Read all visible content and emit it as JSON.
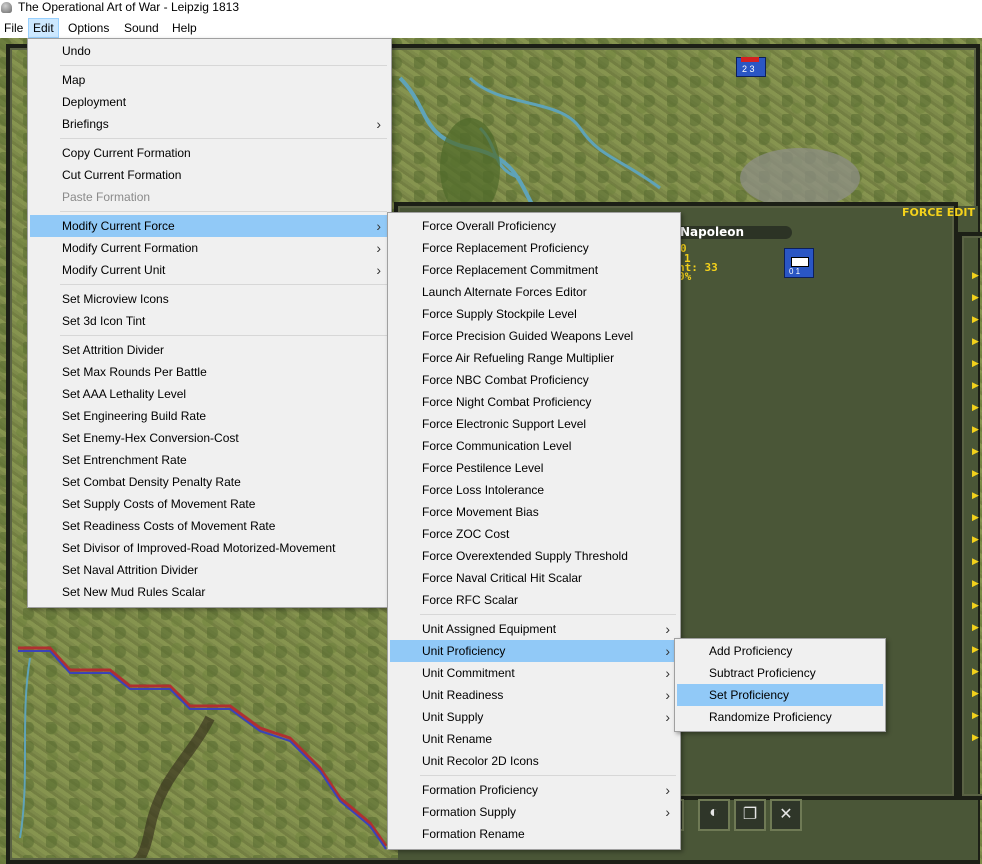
{
  "window": {
    "title": "The Operational Art of War - Leipzig 1813"
  },
  "menubar": [
    "File",
    "Edit",
    "Options",
    "Sound",
    "Help"
  ],
  "edit_menu": [
    {
      "label": "Undo"
    },
    {
      "sep": true
    },
    {
      "label": "Map"
    },
    {
      "label": "Deployment"
    },
    {
      "label": "Briefings",
      "sub": true
    },
    {
      "sep": true
    },
    {
      "label": "Copy Current Formation"
    },
    {
      "label": "Cut Current Formation"
    },
    {
      "label": "Paste Formation",
      "disabled": true
    },
    {
      "sep": true
    },
    {
      "label": "Modify Current Force",
      "sub": true,
      "hl": true
    },
    {
      "label": "Modify Current Formation",
      "sub": true
    },
    {
      "label": "Modify Current Unit",
      "sub": true
    },
    {
      "sep": true
    },
    {
      "label": "Set Microview Icons"
    },
    {
      "label": "Set 3d Icon Tint"
    },
    {
      "sep": true
    },
    {
      "label": "Set Attrition Divider"
    },
    {
      "label": "Set Max Rounds Per Battle"
    },
    {
      "label": "Set AAA Lethality Level"
    },
    {
      "label": "Set Engineering Build Rate"
    },
    {
      "label": "Set Enemy-Hex Conversion-Cost"
    },
    {
      "label": "Set Entrenchment Rate"
    },
    {
      "label": "Set Combat Density Penalty Rate"
    },
    {
      "label": "Set Supply Costs of Movement Rate"
    },
    {
      "label": "Set Readiness Costs of Movement Rate"
    },
    {
      "label": "Set Divisor of Improved-Road Motorized-Movement"
    },
    {
      "label": "Set Naval Attrition Divider"
    },
    {
      "label": "Set New Mud Rules Scalar"
    }
  ],
  "force_menu": [
    {
      "label": "Force Overall Proficiency"
    },
    {
      "label": "Force Replacement Proficiency"
    },
    {
      "label": "Force Replacement Commitment"
    },
    {
      "label": "Launch Alternate Forces Editor"
    },
    {
      "label": "Force Supply Stockpile Level"
    },
    {
      "label": "Force Precision Guided Weapons Level"
    },
    {
      "label": "Force Air Refueling Range Multiplier"
    },
    {
      "label": "Force NBC Combat Proficiency"
    },
    {
      "label": "Force Night Combat Proficiency"
    },
    {
      "label": "Force Electronic Support Level"
    },
    {
      "label": "Force Communication Level"
    },
    {
      "label": "Force Pestilence Level"
    },
    {
      "label": "Force Loss Intolerance"
    },
    {
      "label": "Force Movement Bias"
    },
    {
      "label": "Force ZOC Cost"
    },
    {
      "label": "Force Overextended Supply Threshold"
    },
    {
      "label": "Force Naval Critical Hit Scalar"
    },
    {
      "label": "Force RFC Scalar"
    },
    {
      "sep": true
    },
    {
      "label": "Unit Assigned Equipment",
      "sub": true
    },
    {
      "label": "Unit Proficiency",
      "sub": true,
      "hl": true
    },
    {
      "label": "Unit Commitment",
      "sub": true
    },
    {
      "label": "Unit Readiness",
      "sub": true
    },
    {
      "label": "Unit Supply",
      "sub": true
    },
    {
      "label": "Unit Rename"
    },
    {
      "label": "Unit Recolor 2D Icons"
    },
    {
      "sep": true
    },
    {
      "label": "Formation Proficiency",
      "sub": true
    },
    {
      "label": "Formation Supply",
      "sub": true
    },
    {
      "label": "Formation Rename"
    }
  ],
  "proficiency_menu": [
    {
      "label": "Add Proficiency"
    },
    {
      "label": "Subtract Proficiency"
    },
    {
      "label": "Set Proficiency",
      "hl": true
    },
    {
      "label": "Randomize Proficiency"
    }
  ],
  "game_panel": {
    "header": "FORCE EDIT",
    "commander": "Napoleon",
    "stat_line1": "0",
    "stat_line2": "1",
    "stat_line3": "nt: 33",
    "stat_line4": "0%",
    "unit_values": "0 1",
    "counter_top": "2 3"
  },
  "colors": {
    "menu_bg": "#f0f0f0",
    "highlight": "#91c9f7",
    "accent": "#f4d21b"
  }
}
